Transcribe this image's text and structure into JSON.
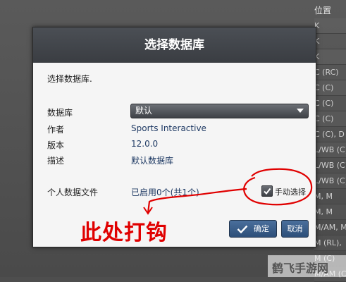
{
  "background": {
    "column_header": "位置",
    "rows": [
      "K",
      "K",
      "K",
      "C (RC)",
      "C (C)",
      "C (C)",
      "C (C)",
      "C (C), D",
      "L/WB (C)",
      "L/WB (C)",
      "L/WB (C)",
      "M, M",
      "M, M",
      "M/AM, M",
      "M (RL),",
      "M (C)",
      "M/AM (C)"
    ]
  },
  "dialog": {
    "title": "选择数据库",
    "section_label": "选择数据库.",
    "database_label": "数据库",
    "database_value": "默认",
    "author_label": "作者",
    "author_value": "Sports Interactive",
    "version_label": "版本",
    "version_value": "12.0.0",
    "description_label": "描述",
    "description_value": "默认数据库",
    "personal_files_label": "个人数据文件",
    "personal_files_value": "已启用0个(共1个)",
    "manual_select_label": "手动选择",
    "manual_select_checked": true,
    "ok_label": "确定",
    "cancel_label": "取消"
  },
  "annotation": {
    "text": "此处打钩",
    "color": "#e00000"
  },
  "watermark": {
    "text": "鹤飞手游网"
  }
}
